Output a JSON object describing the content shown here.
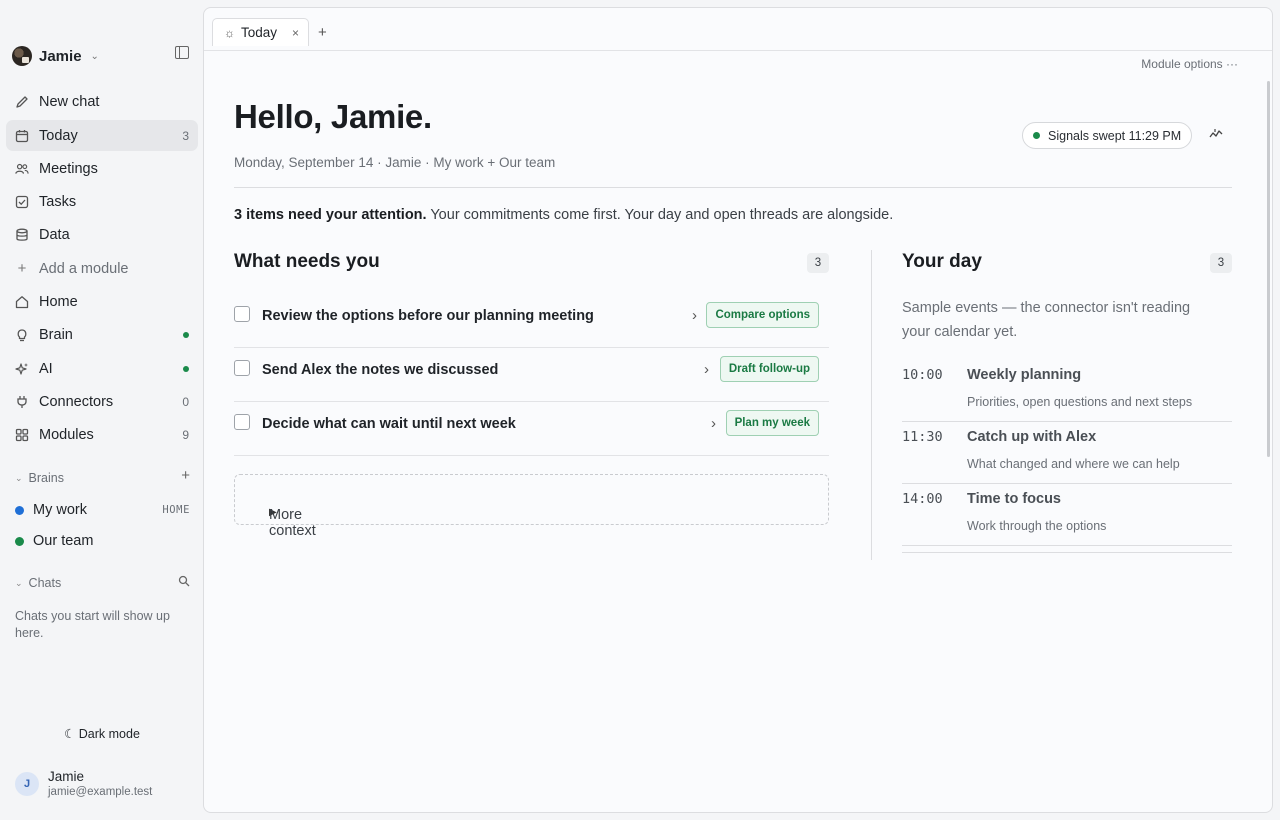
{
  "workspace": {
    "name": "Jamie"
  },
  "nav": [
    {
      "label": "New chat",
      "icon": "pencil-icon"
    },
    {
      "label": "Today",
      "icon": "calendar-icon",
      "count": "3",
      "active": true
    },
    {
      "label": "Meetings",
      "icon": "people-icon"
    },
    {
      "label": "Tasks",
      "icon": "checkbox-icon"
    },
    {
      "label": "Data",
      "icon": "database-icon"
    },
    {
      "label": "Add a module",
      "icon": "plus-icon"
    },
    {
      "label": "Home",
      "icon": "home-icon"
    },
    {
      "label": "Brain",
      "icon": "bulb-icon",
      "status": "online"
    },
    {
      "label": "AI",
      "icon": "sparkle-icon",
      "status": "online"
    },
    {
      "label": "Connectors",
      "icon": "plug-icon",
      "count": "0"
    },
    {
      "label": "Modules",
      "icon": "grid-icon",
      "count": "9"
    }
  ],
  "brains_section": {
    "label": "Brains",
    "items": [
      {
        "label": "My work",
        "tag": "HOME",
        "color": "#1f6fd6"
      },
      {
        "label": "Our team",
        "color": "#1a8a4a"
      }
    ]
  },
  "chats_section": {
    "label": "Chats",
    "empty": "Chats you start will show up here."
  },
  "dark_mode_label": "Dark mode",
  "user": {
    "initial": "J",
    "name": "Jamie",
    "email": "jamie@example.test"
  },
  "tabs": [
    {
      "label": "Today"
    }
  ],
  "module_options": "Module options ···",
  "greeting": "Hello, Jamie.",
  "subline": "Monday, September 14 · Jamie · My work + Our team",
  "signals": {
    "label": "Signals swept 11:29 PM",
    "color": "#1a8a4a"
  },
  "attention": {
    "bold": "3 items need your attention.",
    "rest": " Your commitments come first. Your day and open threads are alongside."
  },
  "needs": {
    "title": "What needs you",
    "count": "3",
    "items": [
      {
        "title": "Review the options before our planning meeting",
        "action": "Compare options"
      },
      {
        "title": "Send Alex the notes we discussed",
        "action": "Draft follow-up"
      },
      {
        "title": "Decide what can wait until next week",
        "action": "Plan my week"
      }
    ],
    "more_context": "More context"
  },
  "day": {
    "title": "Your day",
    "count": "3",
    "note": "Sample events — the connector isn't reading your calendar yet.",
    "events": [
      {
        "time": "10:00",
        "title": "Weekly planning",
        "subtitle": "Priorities, open questions and next steps"
      },
      {
        "time": "11:30",
        "title": "Catch up with Alex",
        "subtitle": "What changed and where we can help"
      },
      {
        "time": "14:00",
        "title": "Time to focus",
        "subtitle": "Work through the options"
      }
    ]
  }
}
